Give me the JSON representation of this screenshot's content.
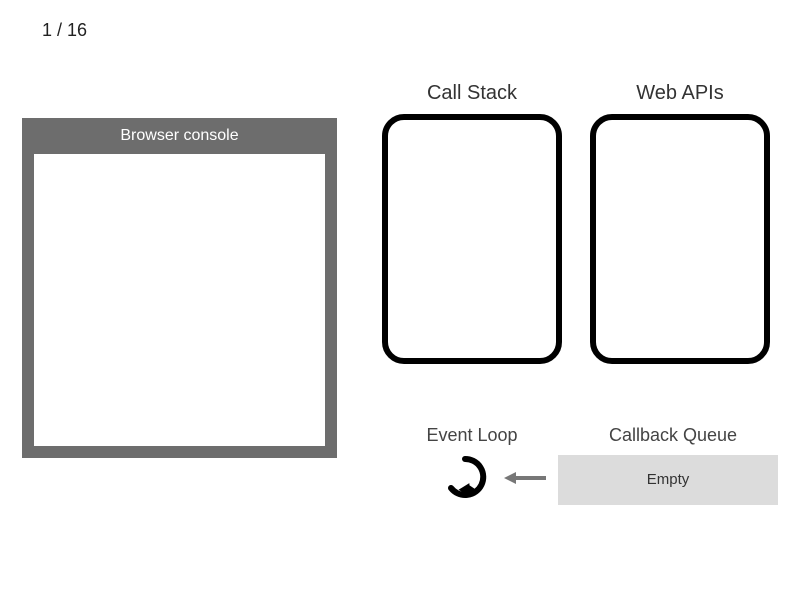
{
  "page": {
    "counter": "1 / 16"
  },
  "console": {
    "title": "Browser console"
  },
  "labels": {
    "call_stack": "Call Stack",
    "web_apis": "Web APIs",
    "event_loop": "Event Loop",
    "callback_queue": "Callback Queue"
  },
  "call_stack": {
    "items": []
  },
  "web_apis": {
    "items": []
  },
  "callback_queue": {
    "status": "Empty",
    "items": []
  }
}
